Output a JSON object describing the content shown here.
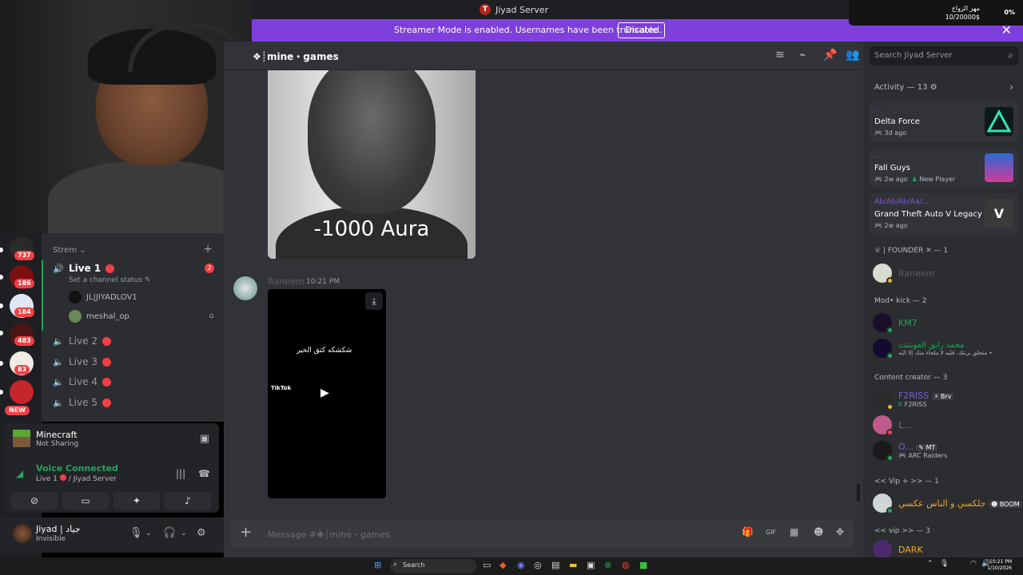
{
  "window": {
    "title": "Jiyad Server",
    "server_badge": "T"
  },
  "widget": {
    "line1": "مهر الزواج",
    "line2": "10/20000$",
    "percent": "0%"
  },
  "banner": {
    "text": "Streamer Mode is enabled. Usernames have been truncated.",
    "button": "Disable",
    "close": "✕"
  },
  "servers": [
    {
      "badge": "737",
      "color": "#2a2a2a"
    },
    {
      "badge": "186",
      "color": "#7a1010"
    },
    {
      "badge": "184",
      "color": "#dfe6f5"
    },
    {
      "badge": "483",
      "color": "#4a1515"
    },
    {
      "badge": "83",
      "color": "#f0ece4"
    },
    {
      "badge": "NEW",
      "color": "#c4262b"
    }
  ],
  "sidebar": {
    "category": "Strem",
    "channels": [
      {
        "name": "Live 1",
        "mention": "2"
      },
      {
        "name": "Live 2"
      },
      {
        "name": "Live 3"
      },
      {
        "name": "Live 4"
      },
      {
        "name": "Live 5"
      }
    ],
    "set_status": "Set a channel status",
    "voice_users": [
      "JL|JIYADLOV1",
      "meshal_op"
    ]
  },
  "activity_panel": {
    "game": "Minecraft",
    "game_status": "Not Sharing",
    "voice_title": "Voice Connected",
    "voice_channel": "Live 1",
    "voice_server": "/ Jiyad Server"
  },
  "user": {
    "name": "Jiyad | جياد",
    "status": "Invisible"
  },
  "chat": {
    "channel": "❖┊mine・games",
    "meme_caption": "-1000 Aura",
    "author": "Raneem",
    "time": "10:21 PM",
    "video_caption": "شكشكه كتق الخير",
    "video_brand": "TikTok",
    "composer_placeholder": "Message #❖┊mine・games"
  },
  "members": {
    "search_placeholder": "Search Jiyad Server",
    "activity_header": "Activity — 13",
    "activities": [
      {
        "user": "...",
        "game": "Delta Force",
        "sub": "3d ago"
      },
      {
        "user": "...",
        "game": "Fall Guys",
        "sub": "2w ago",
        "extra": "New Player"
      },
      {
        "user": "Ab/Ab/Ab/Aa/...",
        "game": "Grand Theft Auto V Legacy",
        "sub": "2w ago"
      }
    ],
    "groups": [
      {
        "label": "♕ | FOUNDER ✕ — 1",
        "members": [
          {
            "name": "Raneem",
            "color": "#5d5f63"
          }
        ]
      },
      {
        "label": "Mod• kick — 2",
        "members": [
          {
            "name": "KM7",
            "color": "#23a55a"
          },
          {
            "name": "محمد رايق الفونتتث",
            "color": "#23a55a",
            "sub": "متحلق برنتك، قلبه لا ملجاء منك إلا اليه •"
          }
        ]
      },
      {
        "label": "Content creator — 3",
        "members": [
          {
            "name": "F2RISS",
            "color": "#7b5cd6",
            "sub": "F2RISS",
            "tag": "Brv"
          },
          {
            "name": "L...",
            "color": "#7b5cd6"
          },
          {
            "name": "O...",
            "color": "#7b5cd6",
            "sub": "ARC Raiders",
            "tag": "MT"
          }
        ]
      },
      {
        "label": "<< Vip + >> — 1",
        "members": [
          {
            "name": "جلكسي و الناس عكسي",
            "color": "#f0a830",
            "tag": "BOOM"
          }
        ]
      },
      {
        "label": "<< vip >> — 3",
        "members": [
          {
            "name": "DARK",
            "color": "#f0a830"
          }
        ]
      }
    ]
  },
  "taskbar": {
    "search": "Search",
    "time": "10:21 PM",
    "date": "1/10/2026"
  }
}
